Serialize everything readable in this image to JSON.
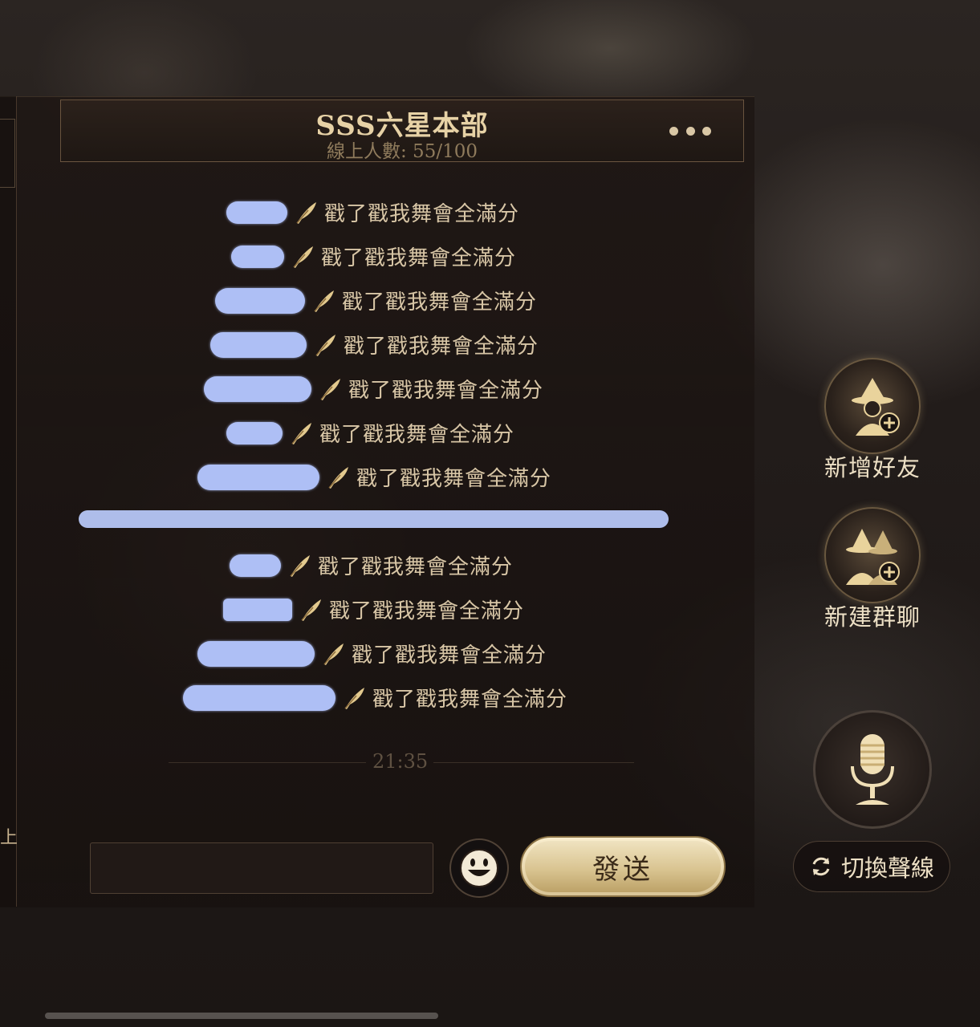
{
  "header": {
    "title": "SSS六星本部",
    "online_label": "線上人數: 55/100",
    "more_icon": "more-dots-icon"
  },
  "messages": [
    {
      "text": "戳了戳我舞會全滿分"
    },
    {
      "text": "戳了戳我舞會全滿分"
    },
    {
      "text": "戳了戳我舞會全滿分"
    },
    {
      "text": "戳了戳我舞會全滿分"
    },
    {
      "text": "戳了戳我舞會全滿分"
    },
    {
      "text": "戳了戳我舞會全滿分"
    },
    {
      "text": "戳了戳我舞會全滿分"
    },
    {
      "text": "戳了戳我舞會全滿分"
    },
    {
      "text": "戳了戳我舞會全滿分"
    },
    {
      "text": "戳了戳我舞會全滿分"
    },
    {
      "text": "戳了戳我舞會全滿分"
    }
  ],
  "timestamp": "21:35",
  "composer": {
    "input_value": "",
    "emoji_icon": "smiley-icon",
    "send_label": "發送"
  },
  "side": {
    "add_friend_label": "新增好友",
    "new_group_label": "新建群聊",
    "switch_label": "切換聲線",
    "mic_icon": "microphone-icon"
  },
  "left_edge_char": "上",
  "colors": {
    "accent_gold": "#e7d2a6",
    "text": "#d8c6a6",
    "redaction": "#aebff5",
    "send_button": "#d9c491"
  }
}
